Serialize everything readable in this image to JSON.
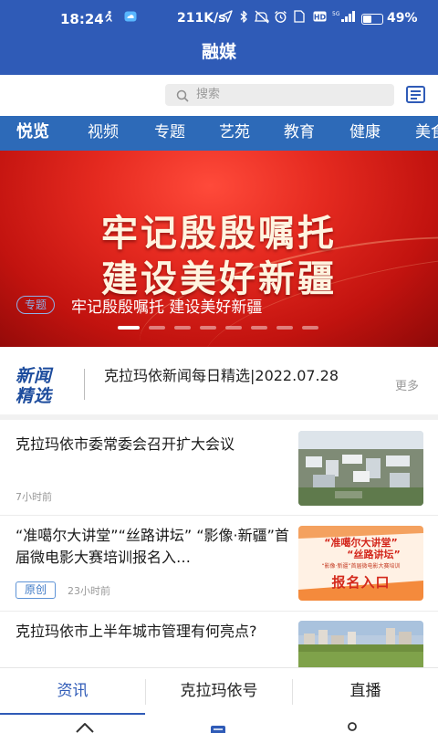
{
  "status_bar": {
    "time": "18:24",
    "network_speed": "211K/s",
    "battery_text": "49%",
    "battery_level": 0.49,
    "icons": [
      "running-app-icon",
      "cloud-app-icon",
      "location-icon",
      "bluetooth-icon",
      "mute-icon",
      "alarm-icon",
      "hd-icon",
      "signal-icon"
    ]
  },
  "header": {
    "title": "融媒"
  },
  "search": {
    "placeholder": "搜索"
  },
  "channels": [
    {
      "label": "悦览",
      "active": true
    },
    {
      "label": "视频",
      "active": false
    },
    {
      "label": "专题",
      "active": false
    },
    {
      "label": "艺苑",
      "active": false
    },
    {
      "label": "教育",
      "active": false
    },
    {
      "label": "健康",
      "active": false
    },
    {
      "label": "美食",
      "active": false
    }
  ],
  "banner": {
    "headline_line1": "牢记殷殷嘱托",
    "headline_line2": "建设美好新疆",
    "tag": "专题",
    "caption": "牢记殷殷嘱托 建设美好新疆",
    "slide_count": 8,
    "active_slide": 1
  },
  "news_pick": {
    "logo_line1": "新闻",
    "logo_line2": "精选",
    "title": "克拉玛依新闻每日精选|2022.07.28",
    "more": "更多"
  },
  "articles": [
    {
      "title": "克拉玛依市委常委会召开扩大会议",
      "badge": "",
      "time": "7小时前",
      "thumb": "city-aerial"
    },
    {
      "title": "“准噶尔大讲堂”“丝路讲坛” “影像·新疆”首届微电影大赛培训报名入…",
      "badge": "原创",
      "time": "23小时前",
      "thumb": "poster",
      "poster": {
        "line1": "“准噶尔大讲堂”",
        "line2": "“丝路讲坛”",
        "line3": "“影像·新疆”首届微电影大赛培训",
        "line4": "报名入口"
      }
    },
    {
      "title": "克拉玛依市上半年城市管理有何亮点?",
      "badge": "",
      "time": "",
      "thumb": "city-field"
    }
  ],
  "bottom_tabs": [
    {
      "label": "资讯",
      "active": true
    },
    {
      "label": "克拉玛依号",
      "active": false
    },
    {
      "label": "直播",
      "active": false
    }
  ],
  "colors": {
    "brand_blue": "#2f5bb7",
    "channel_blue": "#2d6ab8",
    "banner_red": "#d61e17",
    "poster_orange": "#f07a2a",
    "badge_blue": "#3d79c6"
  },
  "nav_icons": [
    "home-icon",
    "news-icon",
    "profile-icon"
  ]
}
